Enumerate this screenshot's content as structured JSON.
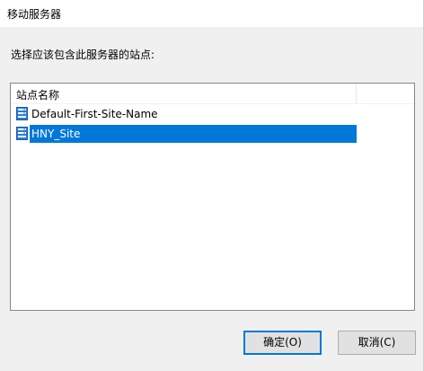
{
  "window": {
    "title": "移动服务器"
  },
  "prompt": "选择应该包含此服务器的站点:",
  "list": {
    "column_header": "站点名称",
    "items": [
      {
        "label": "Default-First-Site-Name",
        "icon": "site-icon",
        "selected": false
      },
      {
        "label": "HNY_Site",
        "icon": "site-icon",
        "selected": true
      }
    ]
  },
  "buttons": {
    "ok_label": "确定(O)",
    "cancel_label": "取消(C)"
  },
  "colors": {
    "selection": "#0078d7",
    "icon": "#2b7cd3"
  }
}
